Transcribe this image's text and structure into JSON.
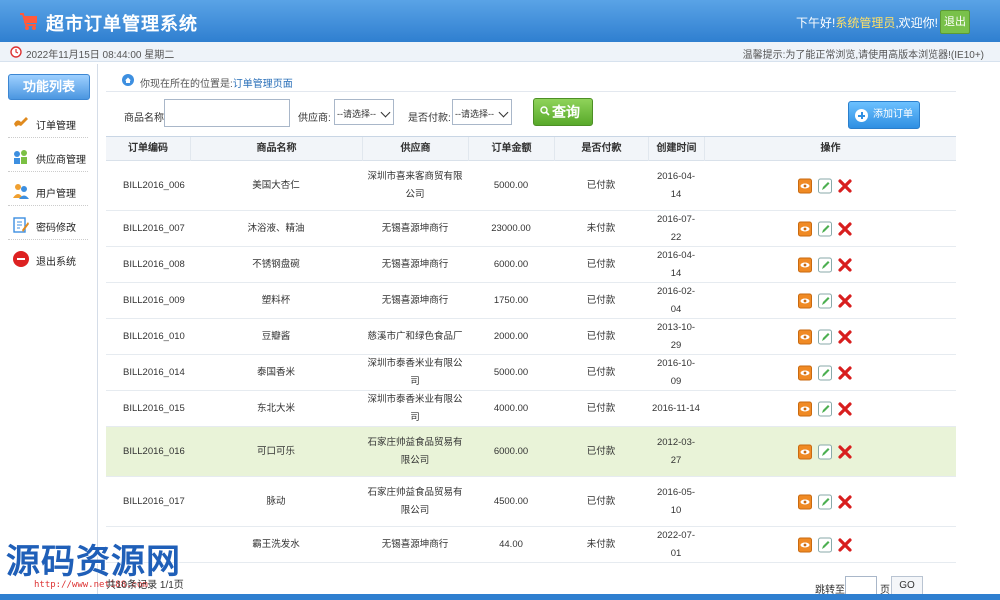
{
  "header": {
    "title": "超市订单管理系统",
    "greeting": "下午好!",
    "role": "系统管理员",
    "welcome": ",欢迎你!",
    "logout_label": "退出"
  },
  "infobar": {
    "datetime": "2022年11月15日 08:44:00 星期二",
    "tip": "温馨提示:为了能正常浏览,请使用高版本浏览器!(IE10+)"
  },
  "sidebar": {
    "title": "功能列表",
    "items": [
      {
        "label": "订单管理",
        "icon": "order-icon"
      },
      {
        "label": "供应商管理",
        "icon": "provider-icon"
      },
      {
        "label": "用户管理",
        "icon": "users-icon"
      },
      {
        "label": "密码修改",
        "icon": "password-icon"
      },
      {
        "label": "退出系统",
        "icon": "exit-icon"
      }
    ]
  },
  "breadcrumb": {
    "prefix": "你现在所在的位置是:",
    "current": "订单管理页面"
  },
  "search": {
    "name_label": "商品名称:",
    "name_value": "",
    "provider_label": "供应商:",
    "provider_selected": "--请选择--",
    "paid_label": "是否付款:",
    "paid_selected": "--请选择--",
    "query_label": "查询",
    "add_label": "添加订单"
  },
  "table": {
    "columns": [
      "订单编码",
      "商品名称",
      "供应商",
      "订单金额",
      "是否付款",
      "创建时间",
      "操作"
    ],
    "rows": [
      {
        "code": "BILL2016_006",
        "name": "美国大杏仁",
        "provider": "深圳市喜来客商贸有限公司",
        "amount": "5000.00",
        "paid": "已付款",
        "date": "2016-04-14"
      },
      {
        "code": "BILL2016_007",
        "name": "沐浴液、精油",
        "provider": "无锡喜源坤商行",
        "amount": "23000.00",
        "paid": "未付款",
        "date": "2016-07-22"
      },
      {
        "code": "BILL2016_008",
        "name": "不锈钢盘碗",
        "provider": "无锡喜源坤商行",
        "amount": "6000.00",
        "paid": "已付款",
        "date": "2016-04-14"
      },
      {
        "code": "BILL2016_009",
        "name": "塑料杯",
        "provider": "无锡喜源坤商行",
        "amount": "1750.00",
        "paid": "已付款",
        "date": "2016-02-04"
      },
      {
        "code": "BILL2016_010",
        "name": "豆瓣酱",
        "provider": "慈溪市广和绿色食品厂",
        "amount": "2000.00",
        "paid": "已付款",
        "date": "2013-10-29"
      },
      {
        "code": "BILL2016_014",
        "name": "泰国香米",
        "provider": "深圳市泰香米业有限公司",
        "amount": "5000.00",
        "paid": "已付款",
        "date": "2016-10-09"
      },
      {
        "code": "BILL2016_015",
        "name": "东北大米",
        "provider": "深圳市泰香米业有限公司",
        "amount": "4000.00",
        "paid": "已付款",
        "date": "2016-11-14"
      },
      {
        "code": "BILL2016_016",
        "name": "可口可乐",
        "provider": "石家庄帅益食品贸易有限公司",
        "amount": "6000.00",
        "paid": "已付款",
        "date": "2012-03-27"
      },
      {
        "code": "BILL2016_017",
        "name": "脉动",
        "provider": "石家庄帅益食品贸易有限公司",
        "amount": "4500.00",
        "paid": "已付款",
        "date": "2016-05-10"
      },
      {
        "code": "",
        "name": "霸王洗发水",
        "provider": "无锡喜源坤商行",
        "amount": "44.00",
        "paid": "未付款",
        "date": "2022-07-01"
      }
    ]
  },
  "pager": {
    "count": "共10条记录   1/1页",
    "jump_label": "跳转至",
    "jump_unit": "页",
    "go_label": "GO"
  },
  "watermark": {
    "text": "源码资源网",
    "url": "http://www.net188.com"
  },
  "colors": {
    "header": "#2f7fd0",
    "accent_green": "#58a92a",
    "highlight_row": "#e9f3d8"
  }
}
